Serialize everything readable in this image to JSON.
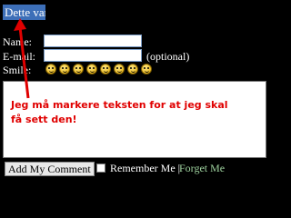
{
  "selected_text": "Dette var",
  "form": {
    "name_label": "Name:",
    "email_label": "E-mail:",
    "optional_label": "(optional)",
    "smile_label": "Smile:",
    "name_value": "",
    "email_value": ""
  },
  "smileys": [
    "smiley",
    "laugh",
    "grin",
    "neutral",
    "wink",
    "sad",
    "shocked",
    "cool"
  ],
  "comment": {
    "annotation": "Jeg må markere teksten for at jeg skal få sett den!"
  },
  "actions": {
    "submit_label": "Add My Comment",
    "remember_label": "Remember Me",
    "separator": "|",
    "forget_label": "Forget Me"
  },
  "colors": {
    "background": "#000000",
    "selection": "#3d6fb8",
    "annotation": "#e00000",
    "forget_link": "#9fd39f"
  }
}
